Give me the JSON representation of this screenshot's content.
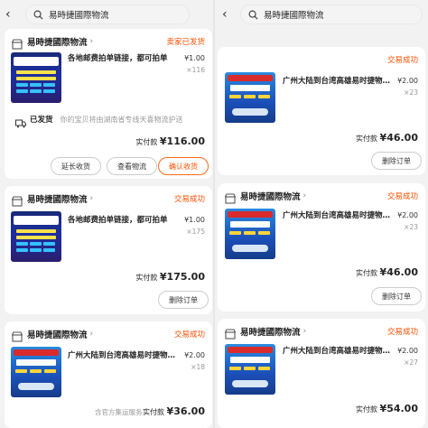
{
  "left": {
    "search": {
      "query": "易時捷國際物流"
    },
    "orders": [
      {
        "shop": "易時捷國際物流",
        "status": "卖家已发货",
        "title": "各地邮费拍单链接，都可拍单",
        "price": "¥1.00",
        "qty": "×116",
        "shipping_label": "已发货",
        "shipping_text": "你的宝贝将由湖南省专线天喜物流护送",
        "total_label": "实付款",
        "total_value": "¥116.00",
        "buttons": [
          "延长收货",
          "查看物流",
          "确认收货"
        ]
      },
      {
        "shop": "易時捷國際物流",
        "status": "交易成功",
        "title": "各地邮费拍单链接，都可拍单",
        "price": "¥1.00",
        "qty": "×175",
        "total_label": "实付款",
        "total_value": "¥175.00",
        "buttons": [
          "删除订单"
        ]
      },
      {
        "shop": "易時捷國際物流",
        "status": "交易成功",
        "title": "广州大陆到台湾高雄易时捷物…",
        "price": "¥2.00",
        "qty": "×18",
        "note": "含官方集运服务",
        "total_label": "实付款",
        "total_value": "¥36.00"
      }
    ]
  },
  "right": {
    "search": {
      "query": "易時捷國際物流"
    },
    "orders": [
      {
        "status": "交易成功",
        "title": "广州大陆到台湾高雄易时捷物…",
        "price": "¥2.00",
        "qty": "×23",
        "total_label": "实付款",
        "total_value": "¥46.00",
        "buttons": [
          "删除订单"
        ]
      },
      {
        "shop": "易時捷國際物流",
        "status": "交易成功",
        "title": "广州大陆到台湾高雄易时捷物…",
        "price": "¥2.00",
        "qty": "×23",
        "total_label": "实付款",
        "total_value": "¥46.00",
        "buttons": [
          "删除订单"
        ]
      },
      {
        "shop": "易時捷國際物流",
        "status": "交易成功",
        "title": "广州大陆到台湾高雄易时捷物…",
        "price": "¥2.00",
        "qty": "×27",
        "total_label": "实付款",
        "total_value": "¥54.00"
      }
    ]
  },
  "colors": {
    "accent": "#ff5000",
    "background": "#f2f2f2"
  }
}
